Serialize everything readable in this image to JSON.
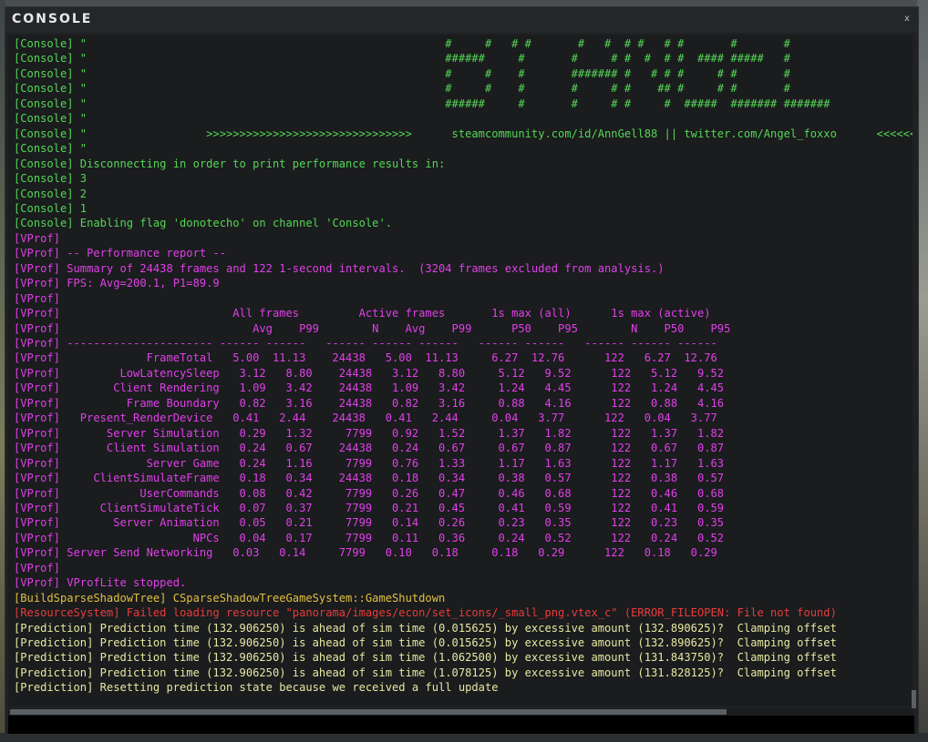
{
  "window": {
    "title": "CONSOLE",
    "close_label": "x"
  },
  "colors": {
    "console": "#55d655",
    "vprof": "#e040e8",
    "build": "#e0c040",
    "resource_error": "#e83c3c",
    "prediction": "#e8e8a0",
    "background": "#1a1c1e"
  },
  "lines": [
    {
      "type": "console",
      "text": "[Console] \"                                                      #     #   # #       #   #  # #   # #       #       #"
    },
    {
      "type": "console",
      "text": "[Console] \"                                                      ######     #       #     # #  #  # #  #### #####   #"
    },
    {
      "type": "console",
      "text": "[Console] \"                                                      #     #    #       ####### #   # # #     # #       #"
    },
    {
      "type": "console",
      "text": "[Console] \"                                                      #     #    #       #     # #    ## #     # #       #"
    },
    {
      "type": "console",
      "text": "[Console] \"                                                      ######     #       #     # #     #  #####  ####### #######"
    },
    {
      "type": "console",
      "text": "[Console] \""
    },
    {
      "type": "console",
      "text": "[Console] \"                  >>>>>>>>>>>>>>>>>>>>>>>>>>>>>>>      steamcommunity.com/id/AnnGell88 || twitter.com/Angel_foxxo      <<<<<<<<<<<"
    },
    {
      "type": "console",
      "text": "[Console] \""
    },
    {
      "type": "console",
      "text": "[Console] Disconnecting in order to print performance results in:"
    },
    {
      "type": "console",
      "text": "[Console] 3"
    },
    {
      "type": "console",
      "text": "[Console] 2"
    },
    {
      "type": "console",
      "text": "[Console] 1"
    },
    {
      "type": "console",
      "text": "[Console] Enabling flag 'donotecho' on channel 'Console'."
    },
    {
      "type": "vprof",
      "text": "[VProf]"
    },
    {
      "type": "vprof",
      "text": "[VProf] -- Performance report --"
    },
    {
      "type": "vprof",
      "text": "[VProf] Summary of 24438 frames and 122 1-second intervals.  (3204 frames excluded from analysis.)"
    },
    {
      "type": "vprof",
      "text": "[VProf] FPS: Avg=200.1, P1=89.9"
    },
    {
      "type": "vprof",
      "text": "[VProf]"
    },
    {
      "type": "vprof",
      "text": "[VProf]                          All frames         Active frames       1s max (all)      1s max (active)"
    },
    {
      "type": "vprof",
      "text": "[VProf]                             Avg    P99        N    Avg    P99      P50    P95        N    P50    P95"
    },
    {
      "type": "vprof",
      "text": "[VProf] ---------------------- ------ ------   ------ ------ ------   ------ ------   ------ ------ ------"
    },
    {
      "type": "vprof",
      "text": "[VProf]             FrameTotal   5.00  11.13    24438   5.00  11.13     6.27  12.76      122   6.27  12.76"
    },
    {
      "type": "vprof",
      "text": "[VProf]         LowLatencySleep   3.12   8.80    24438   3.12   8.80     5.12   9.52      122   5.12   9.52"
    },
    {
      "type": "vprof",
      "text": "[VProf]        Client Rendering   1.09   3.42    24438   1.09   3.42     1.24   4.45      122   1.24   4.45"
    },
    {
      "type": "vprof",
      "text": "[VProf]          Frame Boundary   0.82   3.16    24438   0.82   3.16     0.88   4.16      122   0.88   4.16"
    },
    {
      "type": "vprof",
      "text": "[VProf]   Present_RenderDevice   0.41   2.44    24438   0.41   2.44     0.04   3.77      122   0.04   3.77"
    },
    {
      "type": "vprof",
      "text": "[VProf]       Server Simulation   0.29   1.32     7799   0.92   1.52     1.37   1.82      122   1.37   1.82"
    },
    {
      "type": "vprof",
      "text": "[VProf]       Client Simulation   0.24   0.67    24438   0.24   0.67     0.67   0.87      122   0.67   0.87"
    },
    {
      "type": "vprof",
      "text": "[VProf]             Server Game   0.24   1.16     7799   0.76   1.33     1.17   1.63      122   1.17   1.63"
    },
    {
      "type": "vprof",
      "text": "[VProf]     ClientSimulateFrame   0.18   0.34    24438   0.18   0.34     0.38   0.57      122   0.38   0.57"
    },
    {
      "type": "vprof",
      "text": "[VProf]            UserCommands   0.08   0.42     7799   0.26   0.47     0.46   0.68      122   0.46   0.68"
    },
    {
      "type": "vprof",
      "text": "[VProf]      ClientSimulateTick   0.07   0.37     7799   0.21   0.45     0.41   0.59      122   0.41   0.59"
    },
    {
      "type": "vprof",
      "text": "[VProf]        Server Animation   0.05   0.21     7799   0.14   0.26     0.23   0.35      122   0.23   0.35"
    },
    {
      "type": "vprof",
      "text": "[VProf]                    NPCs   0.04   0.17     7799   0.11   0.36     0.24   0.52      122   0.24   0.52"
    },
    {
      "type": "vprof",
      "text": "[VProf] Server Send Networking   0.03   0.14     7799   0.10   0.18     0.18   0.29      122   0.18   0.29"
    },
    {
      "type": "vprof",
      "text": "[VProf]"
    },
    {
      "type": "vprof",
      "text": "[VProf] VProfLite stopped."
    },
    {
      "type": "build",
      "text": "[BuildSparseShadowTree] CSparseShadowTreeGameSystem::GameShutdown"
    },
    {
      "type": "resource",
      "text": "[ResourceSystem] Failed loading resource \"panorama/images/econ/set_icons/_small_png.vtex_c\" (ERROR_FILEOPEN: File not found)"
    },
    {
      "type": "prediction",
      "text": "[Prediction] Prediction time (132.906250) is ahead of sim time (0.015625) by excessive amount (132.890625)?  Clamping offset"
    },
    {
      "type": "prediction",
      "text": "[Prediction] Prediction time (132.906250) is ahead of sim time (0.015625) by excessive amount (132.890625)?  Clamping offset"
    },
    {
      "type": "prediction",
      "text": "[Prediction] Prediction time (132.906250) is ahead of sim time (1.062500) by excessive amount (131.843750)?  Clamping offset"
    },
    {
      "type": "prediction",
      "text": "[Prediction] Prediction time (132.906250) is ahead of sim time (1.078125) by excessive amount (131.828125)?  Clamping offset"
    },
    {
      "type": "prediction",
      "text": "[Prediction] Resetting prediction state because we received a full update"
    }
  ],
  "input": {
    "value": "",
    "placeholder": ""
  }
}
